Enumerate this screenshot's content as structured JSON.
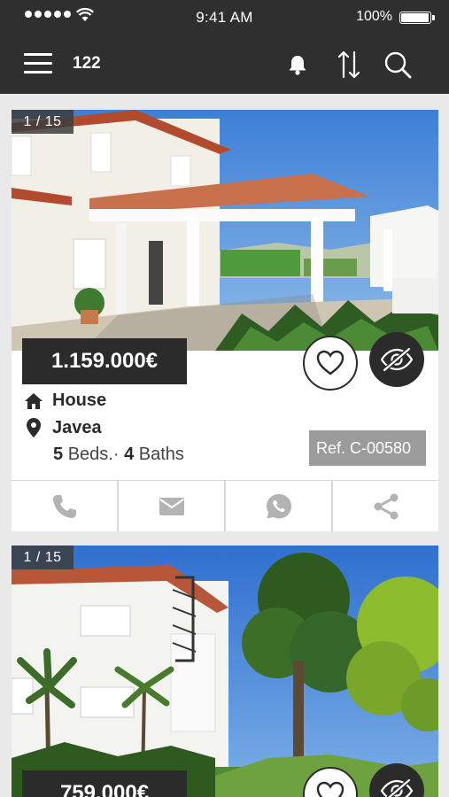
{
  "status_bar": {
    "time": "9:41 AM",
    "battery": "100%",
    "battery_level": 1.0
  },
  "header": {
    "result_count": "122",
    "icons": [
      "menu-icon",
      "bell-icon",
      "sort-icon",
      "search-icon"
    ]
  },
  "listings": [
    {
      "photo_counter": "1 / 15",
      "price": "1.159.000€",
      "type": "House",
      "location": "Javea",
      "beds": "5",
      "beds_label": "Beds.",
      "separator": "·",
      "baths": "4",
      "baths_label": "Baths",
      "ref": "Ref. C-00580",
      "actions": [
        "phone-icon",
        "email-icon",
        "whatsapp-icon",
        "share-icon"
      ]
    },
    {
      "photo_counter": "1 / 15",
      "price": "759.000€"
    }
  ],
  "colors": {
    "header_bg": "#2f2f2f",
    "price_bg": "#2b2b2b",
    "ref_bg": "#9b9b9b",
    "action_icon": "#b3b3b3"
  }
}
